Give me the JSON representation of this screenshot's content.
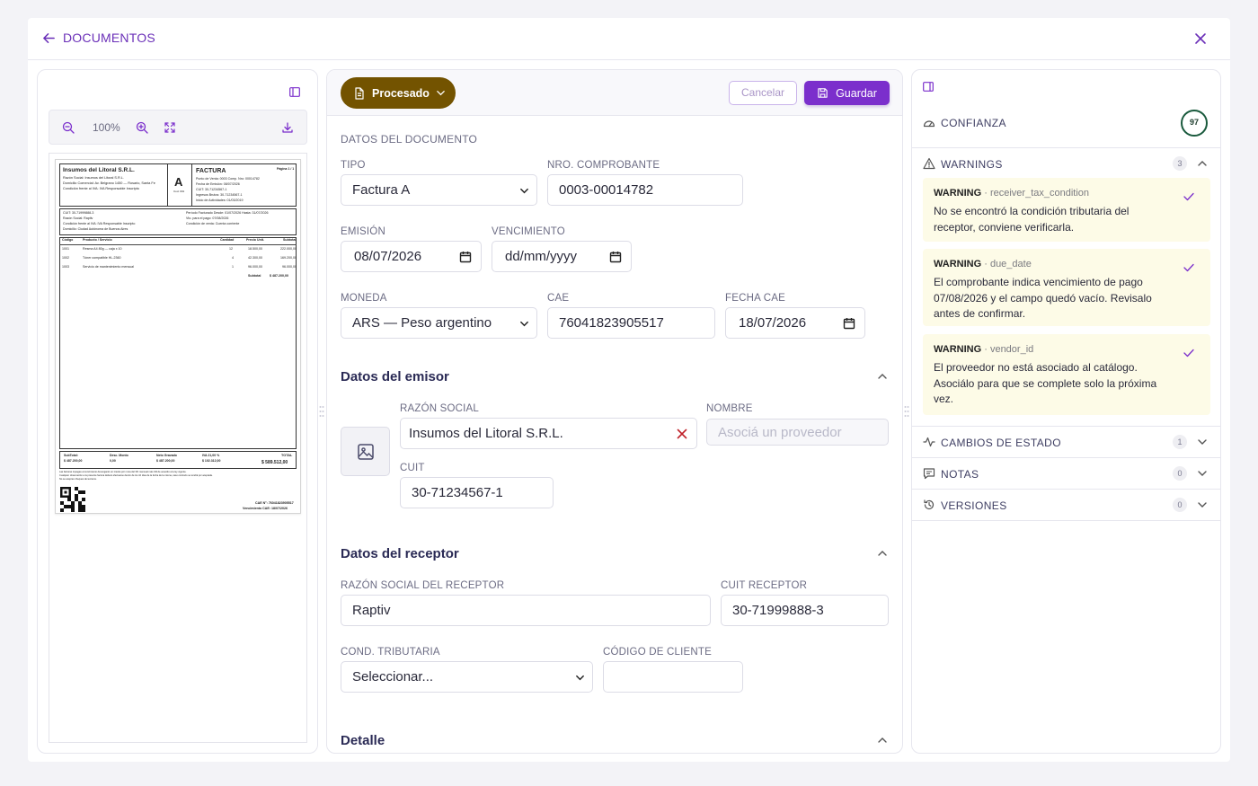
{
  "header": {
    "back_label": "DOCUMENTOS"
  },
  "viewer": {
    "zoom_level": "100%",
    "invoice": {
      "company_name": "Insumos del Litoral S.R.L.",
      "company_lines": [
        "Razón Social: Insumos del Litoral S.R.L.",
        "Domicilio Comercial: Av. Belgrano 1450 — Rosario, Santa Fe",
        "Condición frente al IVA: IVA Responsable Inscripto"
      ],
      "letter": "A",
      "letter_code": "Cod. 001",
      "doc_type": "FACTURA",
      "page": "Página 1 / 1",
      "doc_lines": [
        "Punto de Venta: 0003   Comp. Nro: 00014782",
        "Fecha de Emisión: 08/07/2026",
        "CUIT: 30-71234567-1",
        "Ingresos Brutos: 30-71234567-1",
        "Inicio de Actividades: 01/03/2019"
      ],
      "period_lines": [
        "Período Facturado Desde: 01/07/2026   Hasta: 31/07/2026",
        "Vto. para el pago: 07/08/2026",
        "Condición de venta: Cuenta corriente"
      ],
      "client_lines": [
        "CUIT: 30-71999888-3",
        "Razón Social: Raptiv",
        "Condición frente al IVA: IVA Responsable Inscripto",
        "Domicilio: Ciudad Autónoma de Buenos Aires"
      ],
      "table_headers": [
        "Código",
        "Producto / Servicio",
        "Cantidad",
        "Precio Unit.",
        "Subtotal"
      ],
      "rows": [
        [
          "1001",
          "Resma A4 80g — caja x 10",
          "12",
          "18.500,00",
          "222.000,00"
        ],
        [
          "1002",
          "Tóner compatible HL-2360",
          "4",
          "42.300,00",
          "169.200,00"
        ],
        [
          "1003",
          "Servicio de mantenimiento mensual",
          "1",
          "96.000,00",
          "96.000,00"
        ]
      ],
      "subtotal_label": "Subtotal",
      "subtotal_value": "$ 487.200,00",
      "totals": [
        {
          "label": "SubTotal:",
          "value": "$ 487.200,00"
        },
        {
          "label": "Desc. Monto",
          "value": "0,00"
        },
        {
          "label": "Neto Gravado",
          "value": "$ 487.200,00"
        },
        {
          "label": "IVA 21,00 %",
          "value": "$ 102.312,00"
        }
      ],
      "total_label": "TOTAL",
      "total_value": "$ 589.512,00",
      "legal_1": "Las facturas impagas al vencimiento devengarán un interés por mora del 3% mensual más IVA de acuerdo a la ley vigente.",
      "legal_2": "Cualquier observación a la presente factura deberá efectuarse dentro de los 10 días de la fecha de la misma, caso contrario se tendrá por aceptada.",
      "legal_3": "No se aceptan cheques de terceros.",
      "cae_line": "CAE N°: 76041823905517",
      "cae_due_line": "Vencimiento CAE: 18/07/2026"
    }
  },
  "editor": {
    "status_label": "Procesado",
    "cancel_label": "Cancelar",
    "save_label": "Guardar",
    "section_document": "DATOS DEL DOCUMENTO",
    "tipo_label": "TIPO",
    "tipo_value": "Factura A",
    "nro_label": "NRO. COMPROBANTE",
    "nro_value": "0003-00014782",
    "emision_label": "EMISIÓN",
    "emision_value": "08/07/2026",
    "vencimiento_label": "VENCIMIENTO",
    "vencimiento_value": "dd/mm/yyyy",
    "moneda_label": "MONEDA",
    "moneda_value": "ARS — Peso argentino",
    "cae_label": "CAE",
    "cae_value": "76041823905517",
    "fecha_cae_label": "FECHA CAE",
    "fecha_cae_value": "18/07/2026",
    "emisor_title": "Datos del emisor",
    "razon_social_label": "RAZÓN SOCIAL",
    "razon_social_value": "Insumos del Litoral S.R.L.",
    "nombre_label": "NOMBRE",
    "nombre_placeholder": "Asociá un proveedor",
    "cuit_label": "CUIT",
    "cuit_value": "30-71234567-1",
    "receptor_title": "Datos del receptor",
    "razon_receptor_label": "RAZÓN SOCIAL DEL RECEPTOR",
    "razon_receptor_value": "Raptiv",
    "cuit_receptor_label": "CUIT RECEPTOR",
    "cuit_receptor_value": "30-71999888-3",
    "cond_label": "COND. TRIBUTARIA",
    "cond_value": "Seleccionar...",
    "codigo_label": "CÓDIGO DE CLIENTE",
    "codigo_value": "",
    "detalle_title": "Detalle"
  },
  "insights": {
    "confianza_label": "CONFIANZA",
    "confianza_score": "97",
    "warnings_label": "WARNINGS",
    "warnings_count": "3",
    "warnings": [
      {
        "tag": "WARNING",
        "field": " · receiver_tax_condition",
        "text": "No se encontró la condición tributaria del receptor, conviene verificarla."
      },
      {
        "tag": "WARNING",
        "field": " · due_date",
        "text": "El comprobante indica vencimiento de pago 07/08/2026 y el campo quedó vacío. Revisalo antes de confirmar."
      },
      {
        "tag": "WARNING",
        "field": " · vendor_id",
        "text": "El proveedor no está asociado al catálogo. Asociálo para que se complete solo la próxima vez."
      }
    ],
    "cambios_label": "CAMBIOS DE ESTADO",
    "cambios_count": "1",
    "notas_label": "NOTAS",
    "notas_count": "0",
    "versiones_label": "VERSIONES",
    "versiones_count": "0"
  },
  "colors": {
    "accent": "#7b2fcc",
    "status": "#735300",
    "warning_bg": "#fdfbe7",
    "score_ring": "#1a5a3d"
  }
}
